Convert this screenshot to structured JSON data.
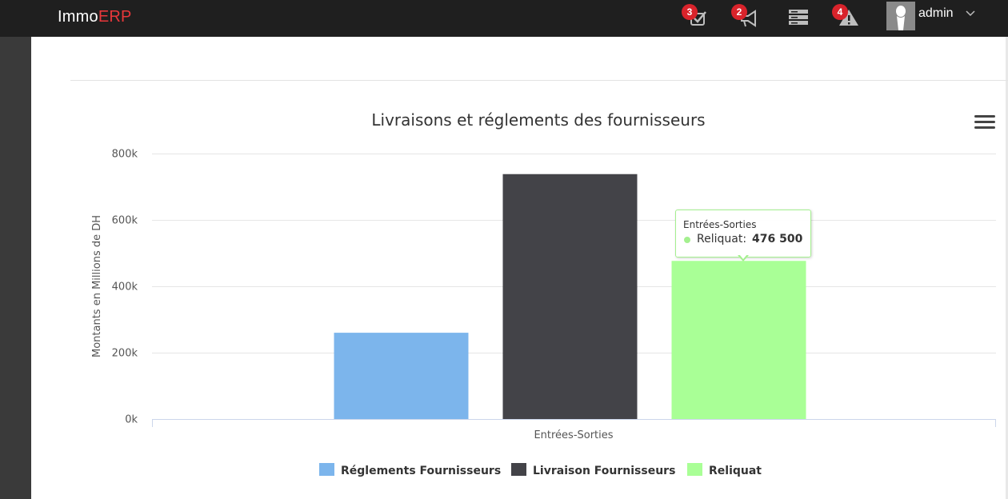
{
  "app": {
    "logo_main": "Immo",
    "logo_accent": "ERP"
  },
  "header": {
    "notifications": [
      {
        "icon": "checklist-icon",
        "badge": "3"
      },
      {
        "icon": "megaphone-icon",
        "badge": "2"
      },
      {
        "icon": "server-icon",
        "badge": ""
      },
      {
        "icon": "warning-icon",
        "badge": "4"
      }
    ],
    "user": {
      "name": "admin"
    }
  },
  "colors": {
    "topbar": "#1f1f1f",
    "accent": "#e8373a",
    "badge": "#d9232b"
  },
  "tooltip": {
    "header": "Entrées-Sorties",
    "series": "Reliquat",
    "value": "476 500"
  },
  "chart_data": {
    "type": "bar",
    "title": "Livraisons et réglements des fournisseurs",
    "xlabel": "",
    "ylabel": "Montants en Millions de DH",
    "categories": [
      "Entrées-Sorties"
    ],
    "ylim": [
      0,
      800000
    ],
    "yticks": [
      "0k",
      "200k",
      "400k",
      "600k",
      "800k"
    ],
    "grid": true,
    "legend_position": "bottom",
    "series": [
      {
        "name": "Réglements Fournisseurs",
        "values": [
          260000
        ],
        "color": "#7cb5ec"
      },
      {
        "name": "Livraison Fournisseurs",
        "values": [
          738000
        ],
        "color": "#434348"
      },
      {
        "name": "Reliquat",
        "values": [
          476500
        ],
        "color": "#a9ff96"
      }
    ]
  }
}
